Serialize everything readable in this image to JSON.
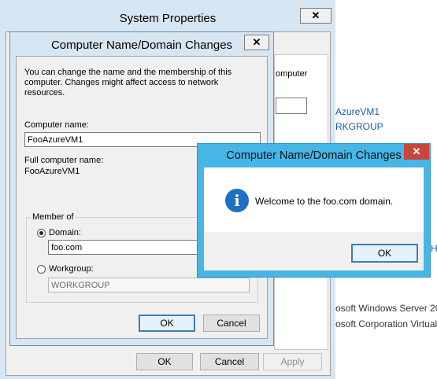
{
  "background": {
    "right_text_computer": "omputer",
    "right_link_1": "AzureVM1",
    "right_link_2": "RKGROUP",
    "right_frag_hc": "HC",
    "right_gray_1": "osoft Windows Server 20",
    "right_gray_2": "osoft Corporation Virtual"
  },
  "system_properties": {
    "title": "System Properties",
    "close_glyph": "✕",
    "buttons": {
      "ok": "OK",
      "cancel": "Cancel",
      "apply": "Apply"
    }
  },
  "computer_name_dialog": {
    "title": "Computer Name/Domain Changes",
    "close_glyph": "✕",
    "intro": "You can change the name and the membership of this computer. Changes might affect access to network resources.",
    "computer_name_label": "Computer name:",
    "computer_name_value": "FooAzureVM1",
    "full_name_label": "Full computer name:",
    "full_name_value": "FooAzureVM1",
    "member_of_label": "Member of",
    "domain_label": "Domain:",
    "domain_value": "foo.com",
    "workgroup_label": "Workgroup:",
    "workgroup_value": "WORKGROUP",
    "buttons": {
      "ok": "OK",
      "cancel": "Cancel"
    }
  },
  "welcome_dialog": {
    "title": "Computer Name/Domain Changes",
    "close_glyph": "✕",
    "icon": "info-icon",
    "icon_glyph": "i",
    "message": "Welcome to the foo.com domain.",
    "ok": "OK"
  },
  "colors": {
    "title_bar_inactive": "#d7e6f3",
    "title_bar_active": "#46b6e6",
    "close_active": "#c7453a",
    "link_blue": "#1c5ca8",
    "info_blue": "#1d70c4"
  }
}
